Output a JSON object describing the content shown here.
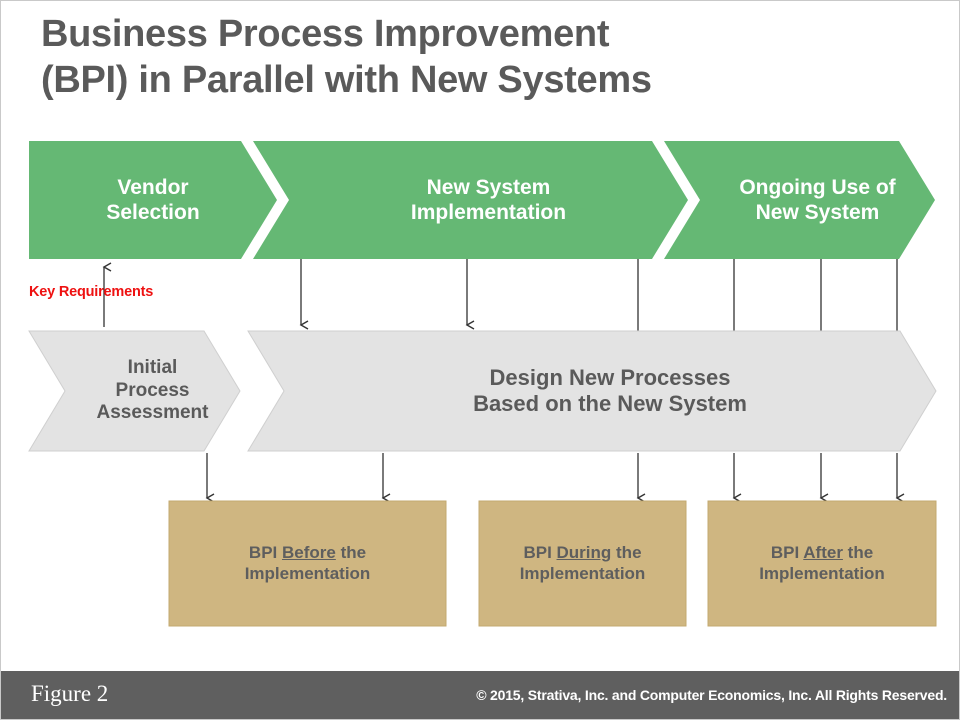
{
  "title": "Business Process Improvement\n(BPI) in Parallel with New Systems",
  "colors": {
    "green": "#65b874",
    "gray_shape": "#e3e3e3",
    "gray_shape_stroke": "#cfcfcf",
    "tan": "#cfb681",
    "tan_stroke": "#c3a970",
    "title_text": "#5a5a5a",
    "note_red": "#ee1111",
    "footer_bg": "#5f5f5f",
    "arrow": "#333333"
  },
  "green_band": {
    "name": "new-system-lifecycle",
    "steps": [
      {
        "label": "Vendor\nSelection"
      },
      {
        "label": "New System\nImplementation"
      },
      {
        "label": "Ongoing Use of\nNew System"
      }
    ]
  },
  "gray_band": {
    "name": "bpi-process-track",
    "steps": [
      {
        "label": "Initial\nProcess\nAssessment"
      },
      {
        "label": "Design New Processes\nBased on the New System"
      }
    ]
  },
  "bpi_boxes": [
    {
      "pre": "BPI ",
      "emphasis": "Before",
      "post": " the\nImplementation"
    },
    {
      "pre": "BPI ",
      "emphasis": "During",
      "post": " the\nImplementation"
    },
    {
      "pre": "BPI ",
      "emphasis": "After",
      "post": " the\nImplementation"
    }
  ],
  "annotations": {
    "key_requirements": "Key Requirements"
  },
  "footer": {
    "figure_number": "Figure 2",
    "copyright": "© 2015, Strativa, Inc. and Computer Economics, Inc. All Rights Reserved."
  }
}
